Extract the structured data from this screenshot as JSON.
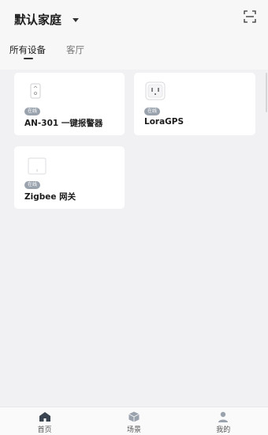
{
  "header": {
    "home_name": "默认家庭",
    "dropdown_icon": "caret-down-icon",
    "scan_icon": "scan-icon"
  },
  "tabs": [
    {
      "label": "所有设备",
      "active": true
    },
    {
      "label": "客厅",
      "active": false
    }
  ],
  "devices": [
    {
      "name": "AN-301 一键报警器",
      "status": "在线",
      "icon": "alarm-button-icon"
    },
    {
      "name": "LoraGPS",
      "status": "在线",
      "icon": "socket-icon"
    },
    {
      "name": "Zigbee 网关",
      "status": "在线",
      "icon": "gateway-icon"
    }
  ],
  "bottom_nav": [
    {
      "label": "首页",
      "icon": "home-icon",
      "active": true
    },
    {
      "label": "场景",
      "icon": "scene-icon",
      "active": false
    },
    {
      "label": "我的",
      "icon": "profile-icon",
      "active": false
    }
  ],
  "colors": {
    "background": "#f1f1f3",
    "card": "#ffffff",
    "badge": "#9aa3ad",
    "text": "#1c1c1c"
  }
}
